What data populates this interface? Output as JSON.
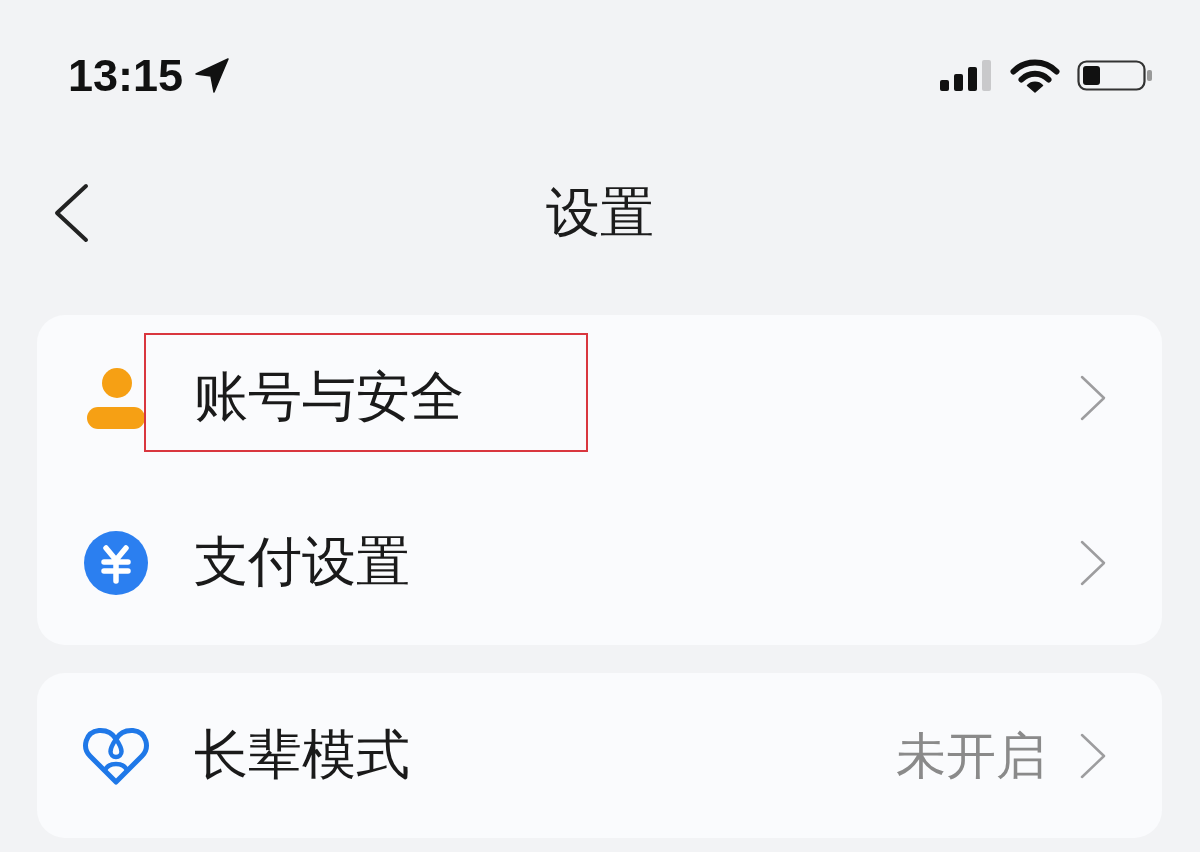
{
  "status_bar": {
    "time": "13:15"
  },
  "nav": {
    "title": "设置"
  },
  "groups": [
    {
      "items": [
        {
          "label": "账号与安全",
          "highlighted": true
        },
        {
          "label": "支付设置",
          "highlighted": false
        }
      ]
    },
    {
      "items": [
        {
          "label": "长辈模式",
          "value": "未开启",
          "highlighted": false
        }
      ]
    }
  ]
}
